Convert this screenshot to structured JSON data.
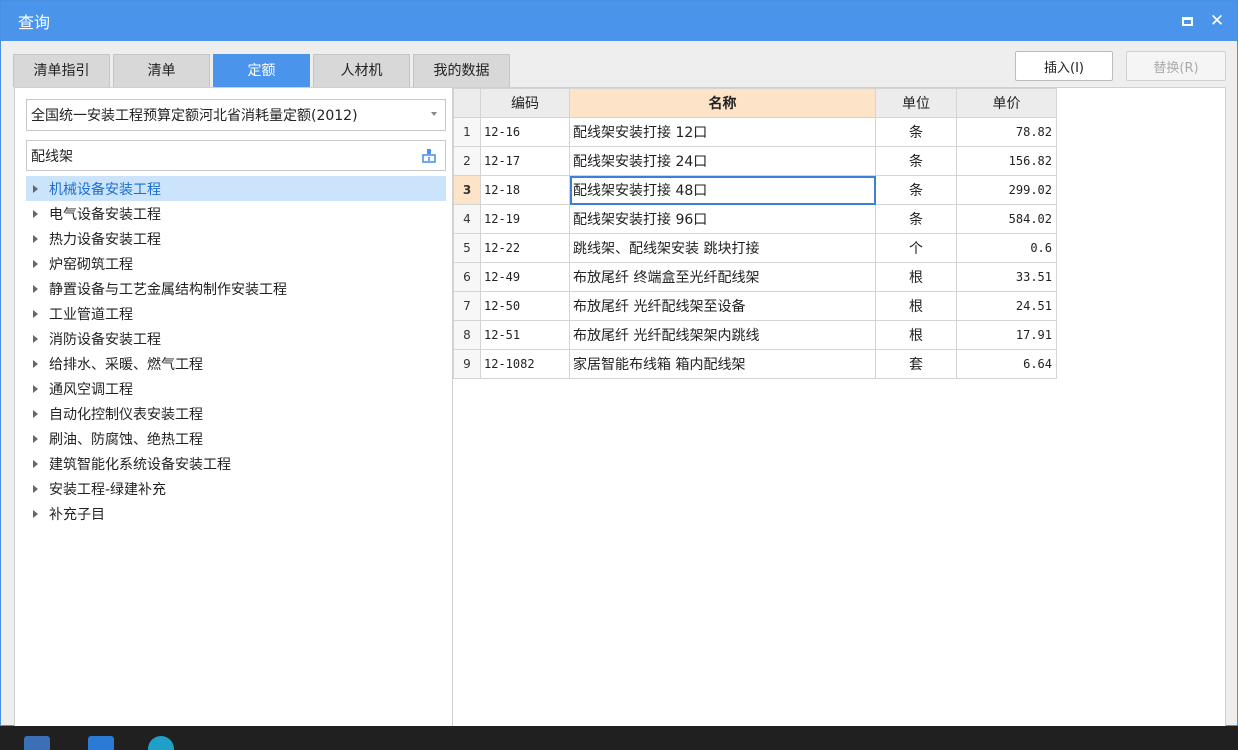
{
  "window": {
    "title": "查询",
    "max_icon": "maximize-icon",
    "close_glyph": "✕"
  },
  "tabs": [
    {
      "label": "清单指引"
    },
    {
      "label": "清单"
    },
    {
      "label": "定额"
    },
    {
      "label": "人材机"
    },
    {
      "label": "我的数据"
    }
  ],
  "active_tab": "定额",
  "buttons": {
    "insert": "插入(I)",
    "replace": "替换(R)"
  },
  "left": {
    "quota_db": "全国统一安装工程预算定额河北省消耗量定额(2012)",
    "search_value": "配线架",
    "tree": [
      "机械设备安装工程",
      "电气设备安装工程",
      "热力设备安装工程",
      "炉窑砌筑工程",
      "静置设备与工艺金属结构制作安装工程",
      "工业管道工程",
      "消防设备安装工程",
      "给排水、采暖、燃气工程",
      "通风空调工程",
      "自动化控制仪表安装工程",
      "刷油、防腐蚀、绝热工程",
      "建筑智能化系统设备安装工程",
      "安装工程-绿建补充",
      "补充子目"
    ],
    "selected_index": 0
  },
  "table": {
    "headers": {
      "code": "编码",
      "name": "名称",
      "unit": "单位",
      "price": "单价"
    },
    "rows": [
      {
        "no": "1",
        "code": "12-16",
        "name": "配线架安装打接 12口",
        "unit": "条",
        "price": "78.82"
      },
      {
        "no": "2",
        "code": "12-17",
        "name": "配线架安装打接 24口",
        "unit": "条",
        "price": "156.82"
      },
      {
        "no": "3",
        "code": "12-18",
        "name": "配线架安装打接 48口",
        "unit": "条",
        "price": "299.02"
      },
      {
        "no": "4",
        "code": "12-19",
        "name": "配线架安装打接 96口",
        "unit": "条",
        "price": "584.02"
      },
      {
        "no": "5",
        "code": "12-22",
        "name": "跳线架、配线架安装 跳块打接",
        "unit": "个",
        "price": "0.6"
      },
      {
        "no": "6",
        "code": "12-49",
        "name": "布放尾纤 终端盒至光纤配线架",
        "unit": "根",
        "price": "33.51"
      },
      {
        "no": "7",
        "code": "12-50",
        "name": "布放尾纤 光纤配线架至设备",
        "unit": "根",
        "price": "24.51"
      },
      {
        "no": "8",
        "code": "12-51",
        "name": "布放尾纤 光纤配线架架内跳线",
        "unit": "根",
        "price": "17.91"
      },
      {
        "no": "9",
        "code": "12-1082",
        "name": "家居智能布线箱 箱内配线架",
        "unit": "套",
        "price": "6.64"
      }
    ],
    "active_row": 2
  },
  "colors": {
    "accent": "#4a94ec",
    "selected_bg": "#cce4fb",
    "header_highlight": "#fde4c8"
  }
}
